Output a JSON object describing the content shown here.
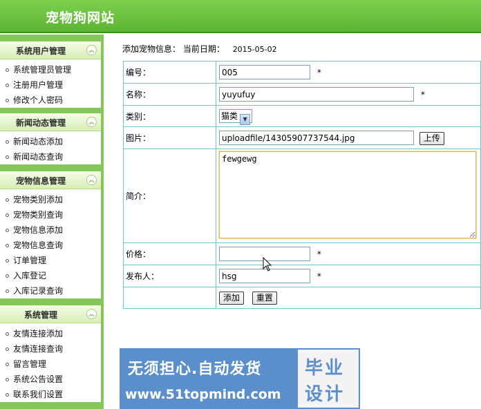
{
  "header": {
    "site_title": "宠物狗网站"
  },
  "sidebar": {
    "groups": [
      {
        "title": "系统用户管理",
        "items": [
          "系统管理员管理",
          "注册用户管理",
          "修改个人密码"
        ]
      },
      {
        "title": "新闻动态管理",
        "items": [
          "新闻动态添加",
          "新闻动态查询"
        ]
      },
      {
        "title": "宠物信息管理",
        "items": [
          "宠物类别添加",
          "宠物类别查询",
          "宠物信息添加",
          "宠物信息查询",
          "订单管理",
          "入库登记",
          "入库记录查询"
        ]
      },
      {
        "title": "系统管理",
        "items": [
          "友情连接添加",
          "友情连接查询",
          "留言管理",
          "系统公告设置",
          "联系我们设置"
        ]
      }
    ],
    "collapse_glyph": "︽"
  },
  "main": {
    "heading": "添加宠物信息：",
    "date_label": "当前日期：",
    "date_value": "2015-05-02",
    "form": {
      "id_label": "编号：",
      "id_value": "005",
      "name_label": "名称：",
      "name_value": "yuyufuy",
      "category_label": "类别：",
      "category_value": "猫类",
      "image_label": "图片：",
      "image_value": "uploadfile/14305907737544.jpg",
      "upload_button": "上传",
      "intro_label": "简介：",
      "intro_value": "fewgewg",
      "price_label": "价格：",
      "price_value": "",
      "publisher_label": "发布人：",
      "publisher_value": "hsg",
      "required_mark": "*",
      "add_button": "添加",
      "reset_button": "重置"
    }
  },
  "watermark": {
    "line1": "无须担心.自动发货",
    "line2": "www.51topmind.com",
    "badge_line1": "毕业",
    "badge_line2": "设计"
  }
}
